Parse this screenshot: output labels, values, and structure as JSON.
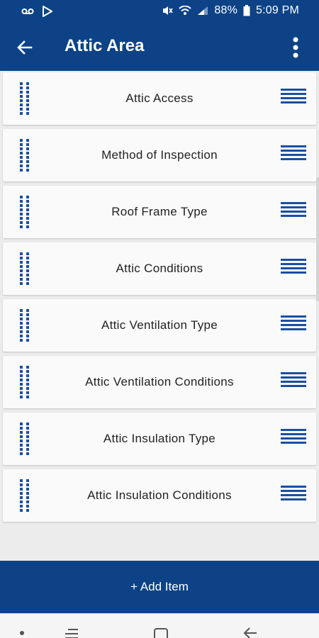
{
  "status_bar": {
    "battery": "88%",
    "time": "5:09 PM"
  },
  "app_bar": {
    "title": "Attic Area"
  },
  "items": [
    {
      "label": "Attic Access"
    },
    {
      "label": "Method of Inspection"
    },
    {
      "label": "Roof Frame Type"
    },
    {
      "label": "Attic Conditions"
    },
    {
      "label": "Attic Ventilation Type"
    },
    {
      "label": "Attic Ventilation Conditions"
    },
    {
      "label": "Attic Insulation Type"
    },
    {
      "label": "Attic Insulation Conditions"
    }
  ],
  "add_button": {
    "label": "+ Add Item"
  },
  "icons": {
    "back": "back-arrow-icon",
    "more": "more-vertical-icon",
    "drag": "drag-handle-icon",
    "menu": "hamburger-menu-icon"
  },
  "colors": {
    "primary": "#0d4386",
    "accent": "#1a4fa0",
    "row_background": "#fafafa",
    "page_background": "#ececec"
  }
}
